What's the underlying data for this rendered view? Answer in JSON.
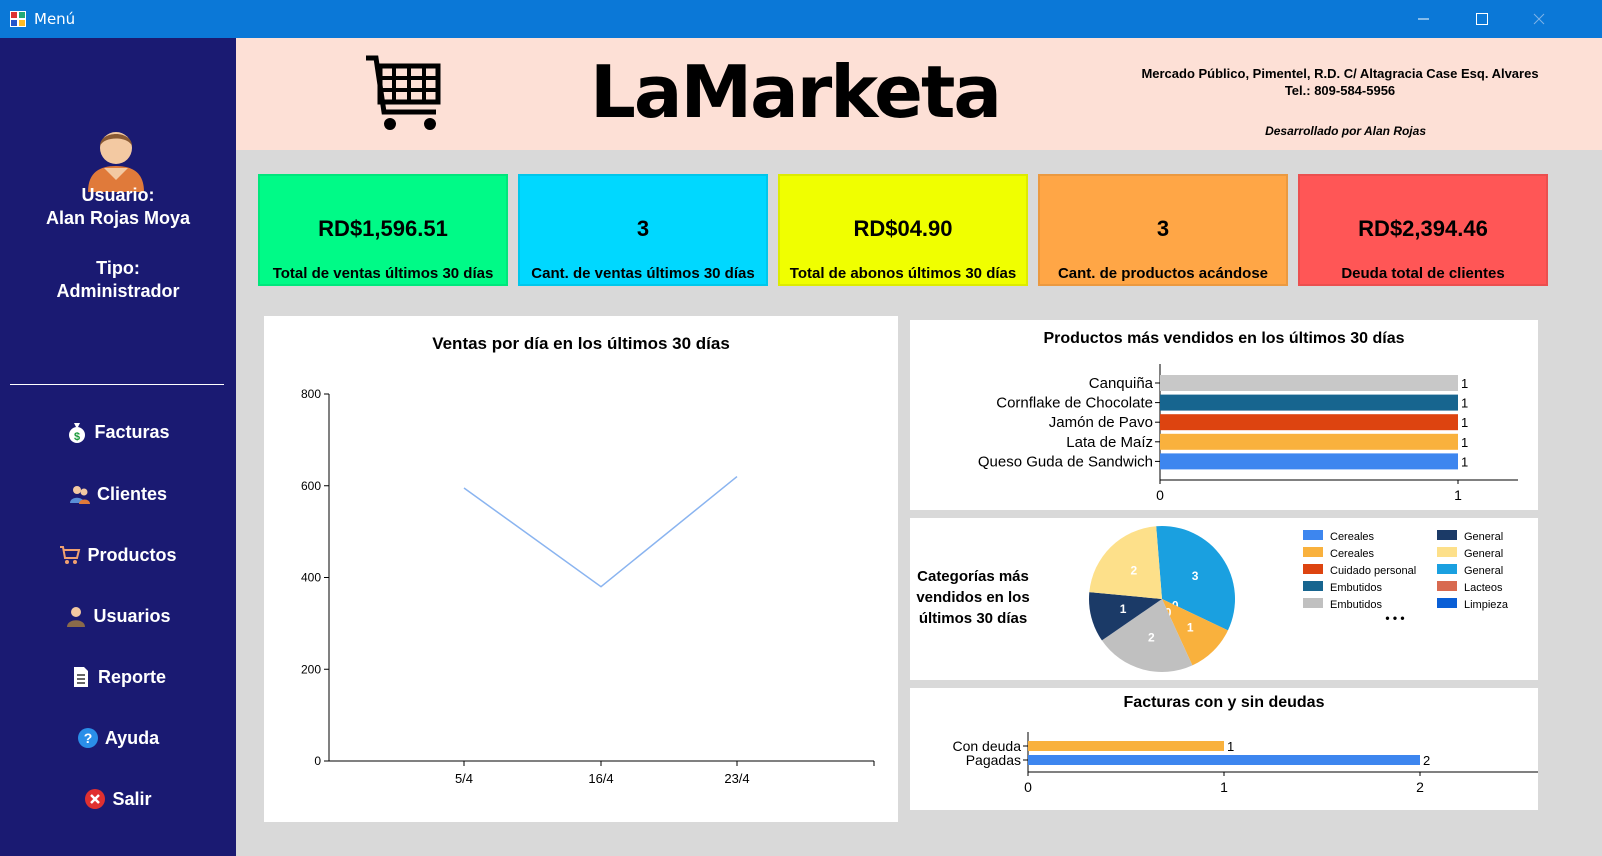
{
  "window": {
    "title": "Menú"
  },
  "sidebar": {
    "user_label": "Usuario:",
    "user_name": "Alan Rojas Moya",
    "type_label": "Tipo:",
    "type_value": "Administrador",
    "menu": [
      {
        "label": "Facturas",
        "icon": "money-bag-icon"
      },
      {
        "label": "Clientes",
        "icon": "clients-icon"
      },
      {
        "label": "Productos",
        "icon": "cart-icon"
      },
      {
        "label": "Usuarios",
        "icon": "user-icon"
      },
      {
        "label": "Reporte",
        "icon": "document-icon"
      },
      {
        "label": "Ayuda",
        "icon": "help-icon"
      },
      {
        "label": "Salir",
        "icon": "close-circle-icon"
      }
    ]
  },
  "header": {
    "brand": "LaMarketa",
    "address": "Mercado Público, Pimentel, R.D. C/ Altagracia Case Esq. Alvares",
    "phone": "Tel.: 809-584-5956",
    "developer": "Desarrollado por Alan Rojas"
  },
  "cards": [
    {
      "value": "RD$1,596.51",
      "label": "Total de ventas últimos 30 días",
      "color": "#00fa87"
    },
    {
      "value": "3",
      "label": "Cant. de ventas últimos 30 días",
      "color": "#00d8ff"
    },
    {
      "value": "RD$04.90",
      "label": "Total de abonos últimos 30 días",
      "color": "#f0ff00"
    },
    {
      "value": "3",
      "label": "Cant. de productos acándose",
      "color": "#ffa646"
    },
    {
      "value": "RD$2,394.46",
      "label": "Deuda total de clientes",
      "color": "#ff5656"
    }
  ],
  "chart_data": [
    {
      "type": "line",
      "title": "Ventas por día en los últimos 30 días",
      "categories": [
        "5/4",
        "16/4",
        "23/4"
      ],
      "values": [
        595,
        380,
        620
      ],
      "ylim": [
        0,
        800
      ],
      "yticks": [
        "0",
        "200",
        "400",
        "600",
        "800"
      ],
      "color": "#8ab4f0"
    },
    {
      "type": "bar",
      "title": "Productos más vendidos en los últimos 30 días",
      "categories": [
        "Canquiña",
        "Cornflake de Chocolate",
        "Jamón de Pavo",
        "Lata de Maíz",
        "Queso Guda de Sandwich"
      ],
      "values": [
        1,
        1,
        1,
        1,
        1
      ],
      "value_labels": [
        "1",
        "1",
        "1",
        "1",
        "1"
      ],
      "colors": [
        "#c8c8c8",
        "#17658f",
        "#dd4410",
        "#f9b13d",
        "#3d86ef"
      ],
      "xticks": [
        "0",
        "1"
      ],
      "xlim": [
        0,
        1
      ]
    },
    {
      "type": "pie",
      "title": "Categorías más vendidos en los últimos 30 días",
      "slices": [
        {
          "value": 3,
          "color": "#1aa0e0",
          "label": "3"
        },
        {
          "value": 0,
          "color": "#0a5fd6",
          "label": "0"
        },
        {
          "value": 1,
          "color": "#f9b13d",
          "label": "1"
        },
        {
          "value": 0,
          "color": "#dd4410",
          "label": "0"
        },
        {
          "value": 2,
          "color": "#c0c0c0",
          "label": "2"
        },
        {
          "value": 1,
          "color": "#1b3a67",
          "label": "1"
        },
        {
          "value": 2,
          "color": "#fde08a",
          "label": "2"
        }
      ],
      "legend": [
        {
          "name": "Cereales",
          "color": "#3d86ef"
        },
        {
          "name": "Cereales",
          "color": "#f9b13d"
        },
        {
          "name": "Cuidado personal",
          "color": "#dd4410"
        },
        {
          "name": "Embutidos",
          "color": "#17658f"
        },
        {
          "name": "Embutidos",
          "color": "#c0c0c0"
        },
        {
          "name": "General",
          "color": "#1b3a67"
        },
        {
          "name": "General",
          "color": "#fde08a"
        },
        {
          "name": "General",
          "color": "#1aa0e0"
        },
        {
          "name": "Lacteos",
          "color": "#d86a50"
        },
        {
          "name": "Limpieza",
          "color": "#0a5fd6"
        }
      ],
      "legend_more": "• • •"
    },
    {
      "type": "bar",
      "title": "Facturas con y sin deudas",
      "categories": [
        "Con deuda",
        "Pagadas"
      ],
      "values": [
        1,
        2
      ],
      "value_labels": [
        "1",
        "2"
      ],
      "colors": [
        "#f9b13d",
        "#3d86ef"
      ],
      "xticks": [
        "0",
        "1",
        "2"
      ],
      "xlim": [
        0,
        2.5
      ]
    }
  ]
}
